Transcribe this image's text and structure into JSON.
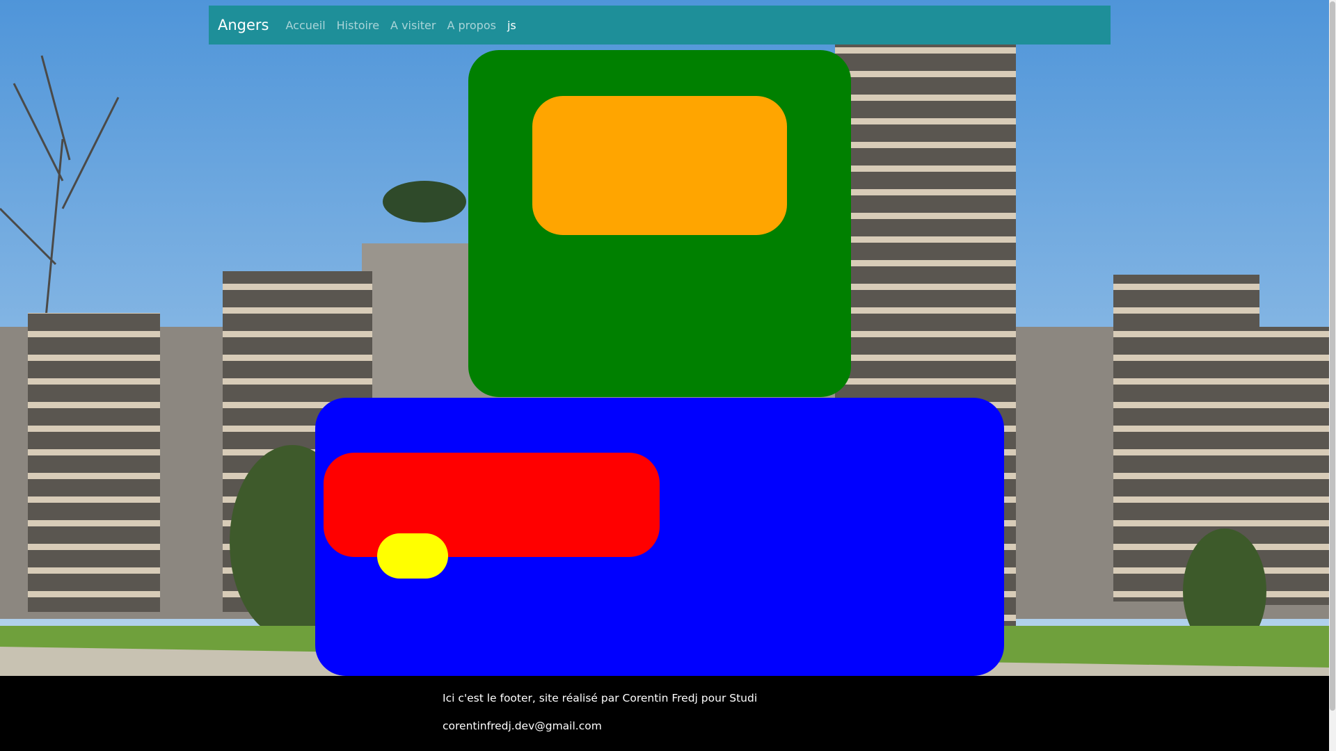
{
  "navbar": {
    "brand": "Angers",
    "links": [
      {
        "label": "Accueil",
        "active": false
      },
      {
        "label": "Histoire",
        "active": false
      },
      {
        "label": "A visiter",
        "active": false
      },
      {
        "label": "A propos",
        "active": false
      },
      {
        "label": "js",
        "active": true
      }
    ]
  },
  "boxes": [
    {
      "name": "green-box",
      "color": "#008000"
    },
    {
      "name": "orange-box",
      "color": "#ffa500"
    },
    {
      "name": "blue-box",
      "color": "#0000ff"
    },
    {
      "name": "red-box",
      "color": "#ff0000"
    },
    {
      "name": "yellow-box",
      "color": "#ffff00"
    }
  ],
  "footer": {
    "line1": "Ici c'est le footer, site réalisé par Corentin Fredj pour Studi",
    "line2": "corentinfredj.dev@gmail.com"
  },
  "colors": {
    "navbar_bg": "#1e8f99",
    "footer_bg": "#000000"
  }
}
